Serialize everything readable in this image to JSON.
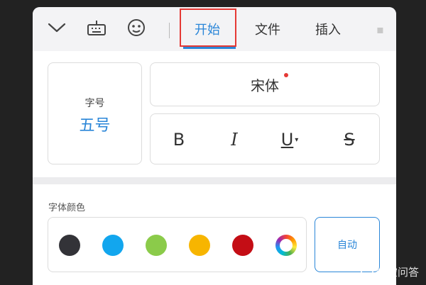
{
  "toolbar": {
    "icons": [
      "chevron-down-icon",
      "keyboard-icon",
      "emoji-icon"
    ],
    "tabs": [
      {
        "label": "开始",
        "active": true
      },
      {
        "label": "文件",
        "active": false
      },
      {
        "label": "插入",
        "active": false
      }
    ]
  },
  "font_panel": {
    "size_label": "字号",
    "size_value": "五号",
    "font_name": "宋体",
    "format_buttons": [
      {
        "name": "bold",
        "glyph": "B"
      },
      {
        "name": "italic",
        "glyph": "I"
      },
      {
        "name": "underline",
        "glyph": "U"
      },
      {
        "name": "strikethrough",
        "glyph": "S"
      }
    ]
  },
  "color_panel": {
    "label": "字体颜色",
    "swatches": [
      "#333338",
      "#12a6ee",
      "#8bcb4a",
      "#f7b500",
      "#c40d15",
      "rainbow"
    ],
    "auto_label": "自动"
  },
  "watermark": {
    "text": "悟空问答"
  },
  "colors": {
    "accent": "#2a86d8",
    "highlight": "#e53935"
  }
}
